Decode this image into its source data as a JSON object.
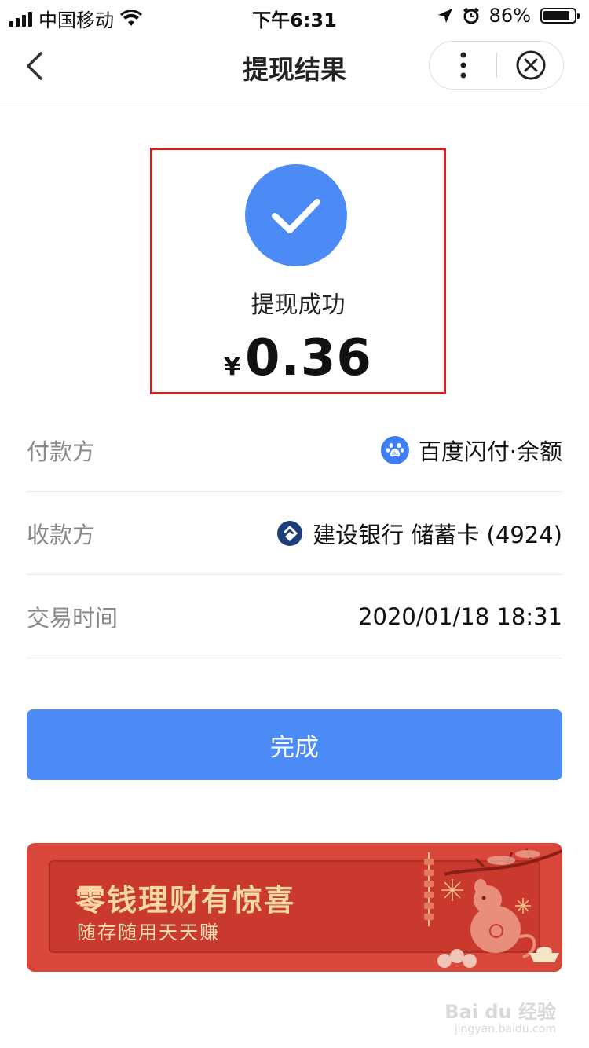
{
  "status_bar": {
    "carrier": "中国移动",
    "time": "下午6:31",
    "battery_percent": "86%",
    "battery_level": 0.86
  },
  "nav": {
    "title": "提现结果",
    "back_icon": "chevron-left-icon",
    "more_icon": "more-vertical-icon",
    "close_icon": "close-circle-icon"
  },
  "result": {
    "status_text": "提现成功",
    "currency_symbol": "¥",
    "amount": "0.36",
    "icon": "check-circle-icon",
    "icon_color": "#4c8bf5"
  },
  "details": [
    {
      "label": "付款方",
      "value": "百度闪付·余额",
      "icon": "baidu-paw-icon"
    },
    {
      "label": "收款方",
      "value": "建设银行 储蓄卡 (4924)",
      "icon": "ccb-bank-icon"
    },
    {
      "label": "交易时间",
      "value": "2020/01/18 18:31",
      "icon": ""
    }
  ],
  "done_button": {
    "label": "完成",
    "color": "#4c8bf5"
  },
  "banner": {
    "title": "零钱理财有惊喜",
    "subtitle": "随存随用天天赚",
    "color": "#d9473a"
  },
  "watermark": {
    "brand": "Bai du 经验",
    "url": "jingyan.baidu.com"
  }
}
